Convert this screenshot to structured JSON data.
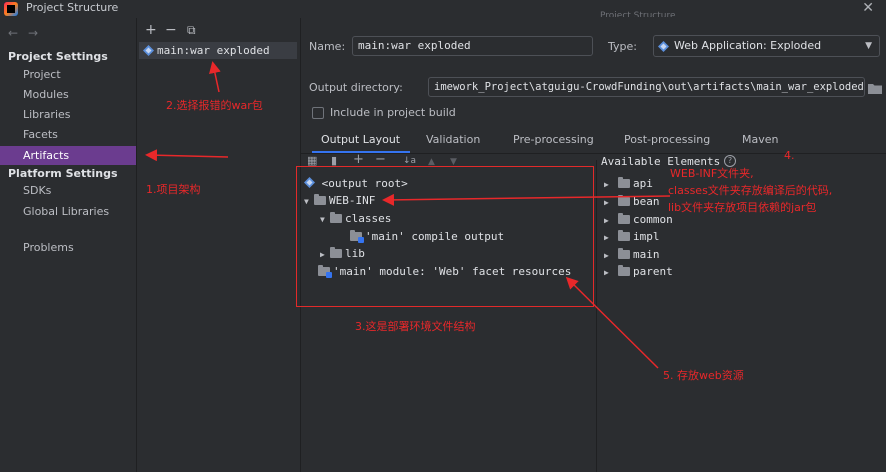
{
  "window": {
    "title": "Project Structure",
    "close_glyph": "✕",
    "ghost_text": "Project Structure"
  },
  "nav": {
    "back_glyph": "←",
    "forward_glyph": "→",
    "project_settings_heading": "Project Settings",
    "project_settings_items": [
      "Project",
      "Modules",
      "Libraries",
      "Facets",
      "Artifacts"
    ],
    "selected_item": "Artifacts",
    "platform_settings_heading": "Platform Settings",
    "platform_items": [
      "SDKs",
      "Global Libraries"
    ],
    "problems": "Problems"
  },
  "artifacts": {
    "toolbar": [
      "+",
      "−",
      "⧉"
    ],
    "items": [
      "main:war exploded"
    ]
  },
  "detail": {
    "name_label": "Name:",
    "name_value": "main:war exploded",
    "type_label": "Type:",
    "type_value": "Web Application: Exploded",
    "output_dir_label": "Output directory:",
    "output_dir_value": "imework_Project\\atguigu-CrowdFunding\\out\\artifacts\\main_war_exploded",
    "include_label": "Include in project build",
    "include_checked": false
  },
  "tabs": [
    "Output Layout",
    "Validation",
    "Pre-processing",
    "Post-processing",
    "Maven"
  ],
  "active_tab": "Output Layout",
  "layout_toolbar": [
    "▦",
    "▮",
    "+",
    "−",
    "↓a",
    "▲",
    "▼"
  ],
  "output_tree": {
    "root": "<output root>",
    "web_inf": "WEB-INF",
    "classes": "classes",
    "compile_output": "'main' compile output",
    "lib": "lib",
    "facet_resources": "'main' module: 'Web' facet resources"
  },
  "available": {
    "title": "Available Elements",
    "help_glyph": "?",
    "items": [
      "api",
      "bean",
      "common",
      "impl",
      "main",
      "parent"
    ]
  },
  "annotations": {
    "a1": "1.项目架构",
    "a2": "2.选择报错的war包",
    "a3": "3.这是部署环境文件结构",
    "a4_num": "4.",
    "a4_line1": "WEB-INF文件夹,",
    "a4_line2": "classes文件夹存放编译后的代码,",
    "a4_line3": "lib文件夹存放项目依赖的jar包",
    "a5": "5. 存放web资源",
    "color": "#e8282a"
  },
  "colors": {
    "background": "#2b2d30",
    "selection": "#6b3c8f",
    "accent": "#3574f0"
  }
}
